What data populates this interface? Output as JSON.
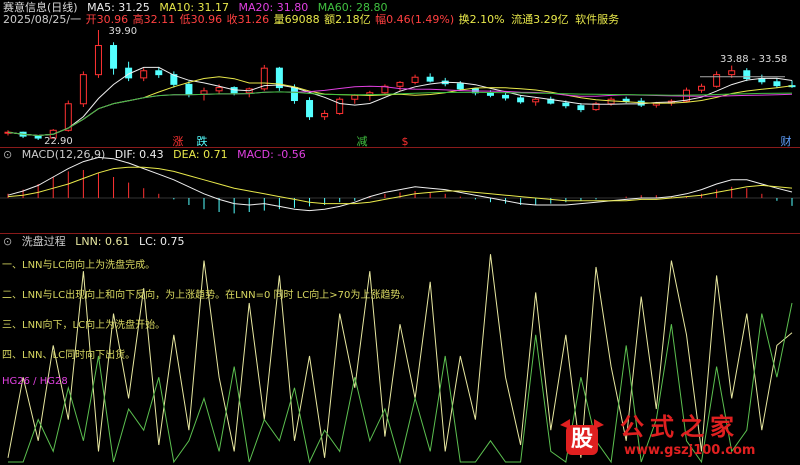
{
  "main": {
    "title": "赛意信息(日线)",
    "ma5": "MA5: 31.25",
    "ma10": "MA10: 31.17",
    "ma20": "MA20: 31.80",
    "ma60": "MA60: 28.80",
    "date": "2025/08/25/一",
    "open": "开30.96",
    "high": "高32.11",
    "low": "低30.96",
    "close": "收31.26",
    "vol": "量69088",
    "amt": "额2.18亿",
    "chg": "幅0.46(1.49%)",
    "turn": "换2.10%",
    "float": "流通3.29亿",
    "sector": "软件服务",
    "label_high": "39.90",
    "label_low": "22.90",
    "label_range": "33.88 - 33.58",
    "mark_up": "涨",
    "mark_down": "跌",
    "mark_reduce": "减",
    "mark_s": "$",
    "mark_fin": "财"
  },
  "macd": {
    "title": "MACD(12,26,9)",
    "dif": "DIF: 0.43",
    "dea": "DEA: 0.71",
    "macd": "MACD: -0.56"
  },
  "wash": {
    "title": "洗盘过程",
    "lnn": "LNN: 0.61",
    "lc": "LC: 0.75",
    "notes": [
      "一、LNN与LC向向上为洗盘完成。",
      "二、LNN与LC出现向上和向下反向，为上涨趋势。在LNN=0 同时 LC向上>70为上涨趋势。",
      "三、LNN向下，LC向上为洗盘开始。",
      "四、LNN、LC同时向下出货。"
    ],
    "hg": "HG26 / HG28"
  },
  "watermark": {
    "logo_char": "股",
    "name": "公式之家",
    "url": "www.gszj100.com"
  },
  "chart_data": [
    {
      "type": "candlestick",
      "title": "赛意信息(日线)",
      "ylim": [
        22.9,
        39.9
      ],
      "candles": [
        [
          24.0,
          24.4,
          23.6,
          24.1
        ],
        [
          24.1,
          24.2,
          23.2,
          23.5
        ],
        [
          23.5,
          23.6,
          22.9,
          23.2
        ],
        [
          23.2,
          24.6,
          23.1,
          24.4
        ],
        [
          24.4,
          29.0,
          24.2,
          28.5
        ],
        [
          28.5,
          33.5,
          28.0,
          33.0
        ],
        [
          33.0,
          39.9,
          32.5,
          37.5
        ],
        [
          37.5,
          38.0,
          33.0,
          34.0
        ],
        [
          34.0,
          35.0,
          32.0,
          32.5
        ],
        [
          32.5,
          34.0,
          32.0,
          33.6
        ],
        [
          33.6,
          34.2,
          32.5,
          33.0
        ],
        [
          33.0,
          33.5,
          31.0,
          31.5
        ],
        [
          31.5,
          32.0,
          29.5,
          30.0
        ],
        [
          30.0,
          31.0,
          29.0,
          30.5
        ],
        [
          30.5,
          31.5,
          30.0,
          31.0
        ],
        [
          31.0,
          31.2,
          29.8,
          30.2
        ],
        [
          30.2,
          31.0,
          29.5,
          30.8
        ],
        [
          30.8,
          34.5,
          30.5,
          34.0
        ],
        [
          34.0,
          34.2,
          30.5,
          31.0
        ],
        [
          31.0,
          31.5,
          28.5,
          29.0
        ],
        [
          29.0,
          29.5,
          26.0,
          26.5
        ],
        [
          26.5,
          27.5,
          26.0,
          27.0
        ],
        [
          27.0,
          29.5,
          26.8,
          29.2
        ],
        [
          29.2,
          30.0,
          28.5,
          29.8
        ],
        [
          29.8,
          30.5,
          29.0,
          30.2
        ],
        [
          30.2,
          31.5,
          30.0,
          31.2
        ],
        [
          31.2,
          32.0,
          30.5,
          31.8
        ],
        [
          31.8,
          33.0,
          31.5,
          32.6
        ],
        [
          32.6,
          33.2,
          31.8,
          32.0
        ],
        [
          32.0,
          32.5,
          31.2,
          31.6
        ],
        [
          31.6,
          32.0,
          30.5,
          30.8
        ],
        [
          30.8,
          31.0,
          29.8,
          30.2
        ],
        [
          30.2,
          30.6,
          29.5,
          29.8
        ],
        [
          29.8,
          30.2,
          29.0,
          29.4
        ],
        [
          29.4,
          29.8,
          28.5,
          28.8
        ],
        [
          28.8,
          29.4,
          28.2,
          29.2
        ],
        [
          29.2,
          29.6,
          28.4,
          28.6
        ],
        [
          28.6,
          29.0,
          27.8,
          28.2
        ],
        [
          28.2,
          28.6,
          27.2,
          27.6
        ],
        [
          27.6,
          28.8,
          27.4,
          28.5
        ],
        [
          28.5,
          29.5,
          28.2,
          29.2
        ],
        [
          29.2,
          29.6,
          28.6,
          28.9
        ],
        [
          28.9,
          29.4,
          28.0,
          28.3
        ],
        [
          28.3,
          28.8,
          27.9,
          28.6
        ],
        [
          28.6,
          29.2,
          28.2,
          28.9
        ],
        [
          28.9,
          31.0,
          28.7,
          30.6
        ],
        [
          30.6,
          31.6,
          30.2,
          31.2
        ],
        [
          31.2,
          33.5,
          31.0,
          33.0
        ],
        [
          33.0,
          34.4,
          32.5,
          33.6
        ],
        [
          33.6,
          34.0,
          32.0,
          32.4
        ],
        [
          32.4,
          33.0,
          31.5,
          31.9
        ],
        [
          31.9,
          32.4,
          31.0,
          31.3
        ],
        [
          31.3,
          32.1,
          30.96,
          31.26
        ]
      ]
    },
    {
      "type": "bar",
      "title": "MACD(12,26,9)",
      "series": [
        {
          "name": "DIF",
          "value": 0.43
        },
        {
          "name": "DEA",
          "value": 0.71
        },
        {
          "name": "MACD",
          "value": -0.56
        }
      ],
      "macd_hist": [
        0.3,
        0.6,
        1.0,
        1.5,
        1.9,
        2.0,
        1.8,
        1.5,
        1.1,
        0.7,
        0.3,
        -0.1,
        -0.5,
        -0.8,
        -1.0,
        -1.1,
        -1.0,
        -0.9,
        -0.8,
        -0.7,
        -0.6,
        -0.5,
        -0.3,
        -0.2,
        0.1,
        0.3,
        0.4,
        0.5,
        0.4,
        0.3,
        0.1,
        -0.1,
        -0.3,
        -0.4,
        -0.5,
        -0.5,
        -0.4,
        -0.3,
        -0.2,
        -0.1,
        0.0,
        0.1,
        0.2,
        0.2,
        0.1,
        0.1,
        0.3,
        0.6,
        0.8,
        0.7,
        0.3,
        -0.2,
        -0.56
      ],
      "dif": [
        0.2,
        0.5,
        0.9,
        1.5,
        2.1,
        2.6,
        2.9,
        2.8,
        2.5,
        2.1,
        1.7,
        1.3,
        0.8,
        0.3,
        -0.1,
        -0.4,
        -0.5,
        -0.4,
        -0.6,
        -0.8,
        -0.9,
        -0.8,
        -0.6,
        -0.3,
        0.1,
        0.4,
        0.6,
        0.8,
        0.7,
        0.6,
        0.4,
        0.2,
        0.0,
        -0.2,
        -0.4,
        -0.5,
        -0.5,
        -0.5,
        -0.4,
        -0.3,
        -0.2,
        -0.1,
        0.0,
        0.0,
        0.1,
        0.3,
        0.6,
        1.0,
        1.3,
        1.3,
        1.0,
        0.7,
        0.43
      ],
      "dea": [
        0.1,
        0.2,
        0.4,
        0.7,
        1.0,
        1.4,
        1.8,
        2.1,
        2.2,
        2.2,
        2.1,
        1.9,
        1.6,
        1.3,
        1.0,
        0.7,
        0.5,
        0.3,
        0.1,
        -0.1,
        -0.3,
        -0.4,
        -0.4,
        -0.4,
        -0.3,
        -0.1,
        0.1,
        0.3,
        0.4,
        0.5,
        0.5,
        0.4,
        0.3,
        0.2,
        0.1,
        0.0,
        -0.1,
        -0.2,
        -0.2,
        -0.2,
        -0.2,
        -0.2,
        -0.1,
        -0.1,
        0.0,
        0.1,
        0.2,
        0.4,
        0.6,
        0.8,
        0.9,
        0.8,
        0.71
      ]
    },
    {
      "type": "line",
      "title": "洗盘过程",
      "ylim": [
        0,
        100
      ],
      "series": [
        {
          "name": "LNN",
          "values": [
            2,
            40,
            10,
            55,
            20,
            90,
            5,
            70,
            30,
            82,
            8,
            60,
            15,
            95,
            40,
            5,
            75,
            20,
            88,
            10,
            50,
            2,
            70,
            35,
            90,
            12,
            65,
            30,
            85,
            5,
            50,
            20,
            98,
            40,
            8,
            80,
            15,
            60,
            2,
            92,
            45,
            10,
            78,
            25,
            95,
            60,
            5,
            88,
            30,
            70,
            15,
            55,
            61
          ]
        },
        {
          "name": "LC",
          "values": [
            0,
            0,
            20,
            5,
            35,
            10,
            50,
            0,
            25,
            15,
            40,
            0,
            10,
            30,
            5,
            45,
            0,
            20,
            10,
            35,
            0,
            15,
            5,
            40,
            10,
            25,
            0,
            30,
            5,
            50,
            0,
            0,
            10,
            0,
            0,
            60,
            5,
            0,
            40,
            10,
            0,
            55,
            0,
            20,
            65,
            10,
            0,
            45,
            5,
            15,
            70,
            40,
            75
          ]
        }
      ]
    }
  ]
}
